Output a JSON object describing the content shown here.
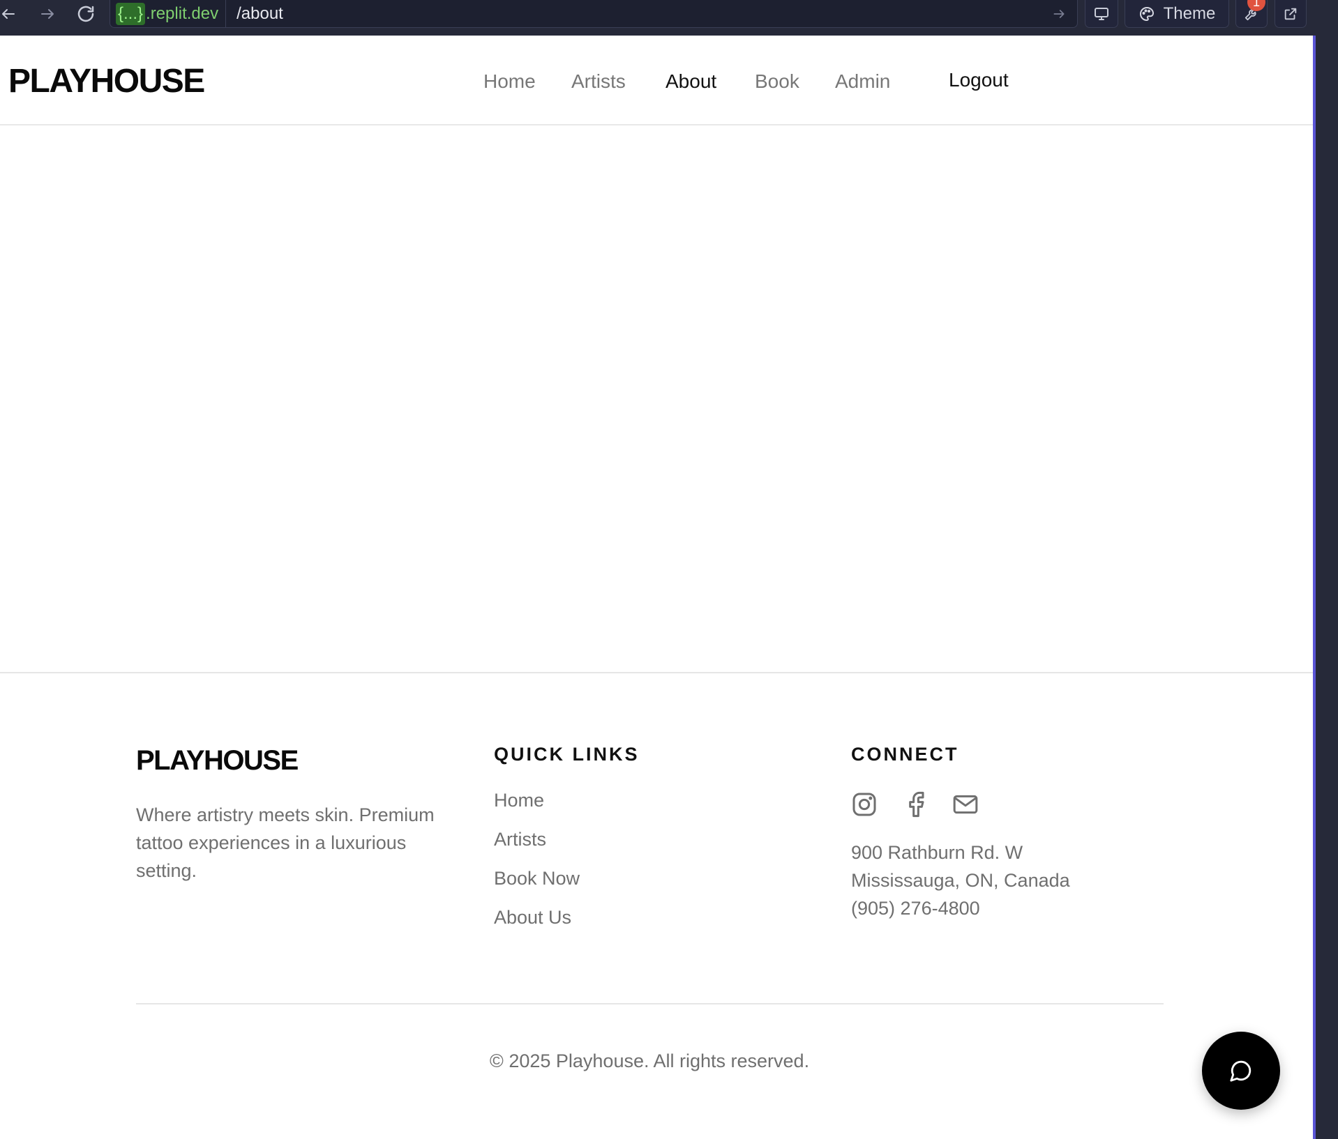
{
  "browser": {
    "url_host_var": "{...}",
    "url_host": ".replit.dev",
    "url_path": "/about",
    "theme_label": "Theme",
    "badge_count": "1",
    "icons": [
      "back-arrow-icon",
      "forward-arrow-icon",
      "reload-icon",
      "go-arrow-icon",
      "monitor-icon",
      "palette-icon",
      "wrench-icon",
      "external-link-icon"
    ]
  },
  "header": {
    "logo": "PLAYHOUSE",
    "nav": [
      {
        "label": "Home"
      },
      {
        "label": "Artists"
      },
      {
        "label": "About"
      },
      {
        "label": "Book"
      },
      {
        "label": "Admin"
      }
    ],
    "active_nav": "About",
    "logout_label": "Logout"
  },
  "footer": {
    "logo": "PLAYHOUSE",
    "tagline": "Where artistry meets skin. Premium tattoo experiences in a luxurious setting.",
    "quick_links_heading": "QUICK LINKS",
    "quick_links": [
      {
        "label": "Home"
      },
      {
        "label": "Artists"
      },
      {
        "label": "Book Now"
      },
      {
        "label": "About Us"
      }
    ],
    "connect_heading": "CONNECT",
    "social_icons": [
      "instagram-icon",
      "facebook-icon",
      "mail-icon"
    ],
    "address_line1": "900 Rathburn Rd. W",
    "address_line2": "Mississauga, ON, Canada",
    "phone": "(905) 276-4800",
    "copyright": "© 2025 Playhouse. All rights reserved."
  },
  "chat": {
    "icon": "chat-bubble-icon"
  },
  "colors": {
    "toolbar_bg": "#262939",
    "url_host": "#7fcf6f",
    "frame_accent": "#5b55d6",
    "text_muted": "#6f6f6f",
    "text_dark": "#111111",
    "badge": "#e0533f",
    "chat_button": "#000000"
  }
}
